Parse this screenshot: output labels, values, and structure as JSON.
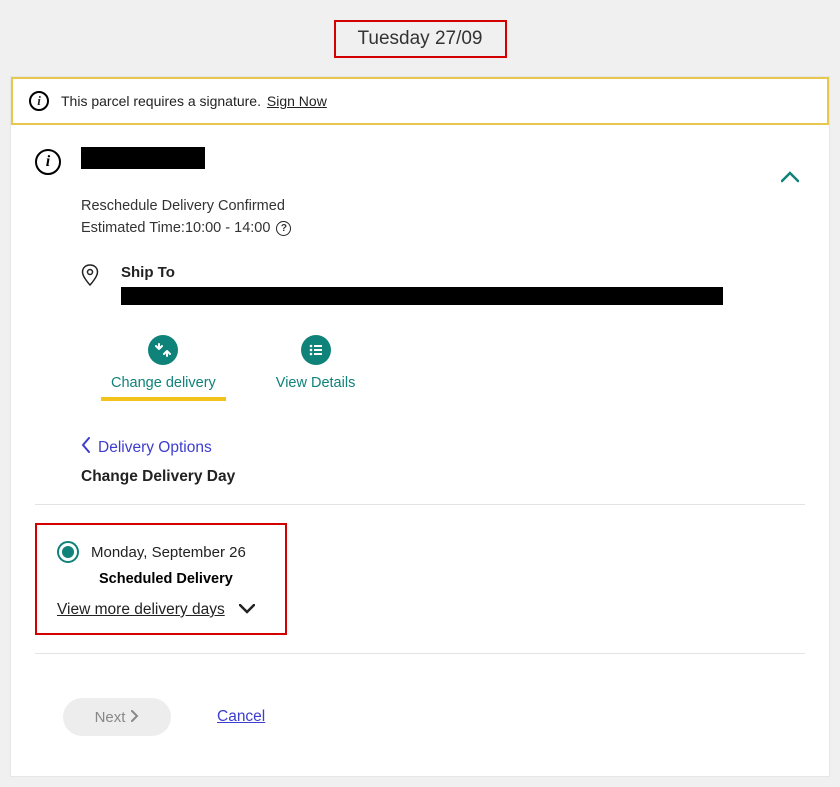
{
  "header": {
    "date": "Tuesday 27/09"
  },
  "banner": {
    "text": "This parcel requires a signature.",
    "sign_now": "Sign Now"
  },
  "status": {
    "line1": "Reschedule Delivery Confirmed",
    "line2_prefix": "Estimated Time: ",
    "time": "10:00 - 14:00"
  },
  "shipto": {
    "label": "Ship To"
  },
  "actions": {
    "change_delivery": "Change delivery",
    "view_details": "View Details"
  },
  "options": {
    "back": "Delivery Options",
    "title": "Change Delivery Day",
    "selected_day": "Monday, September 26",
    "scheduled": "Scheduled Delivery",
    "view_more": "View more delivery days "
  },
  "footer": {
    "next": "Next",
    "cancel": "Cancel"
  }
}
